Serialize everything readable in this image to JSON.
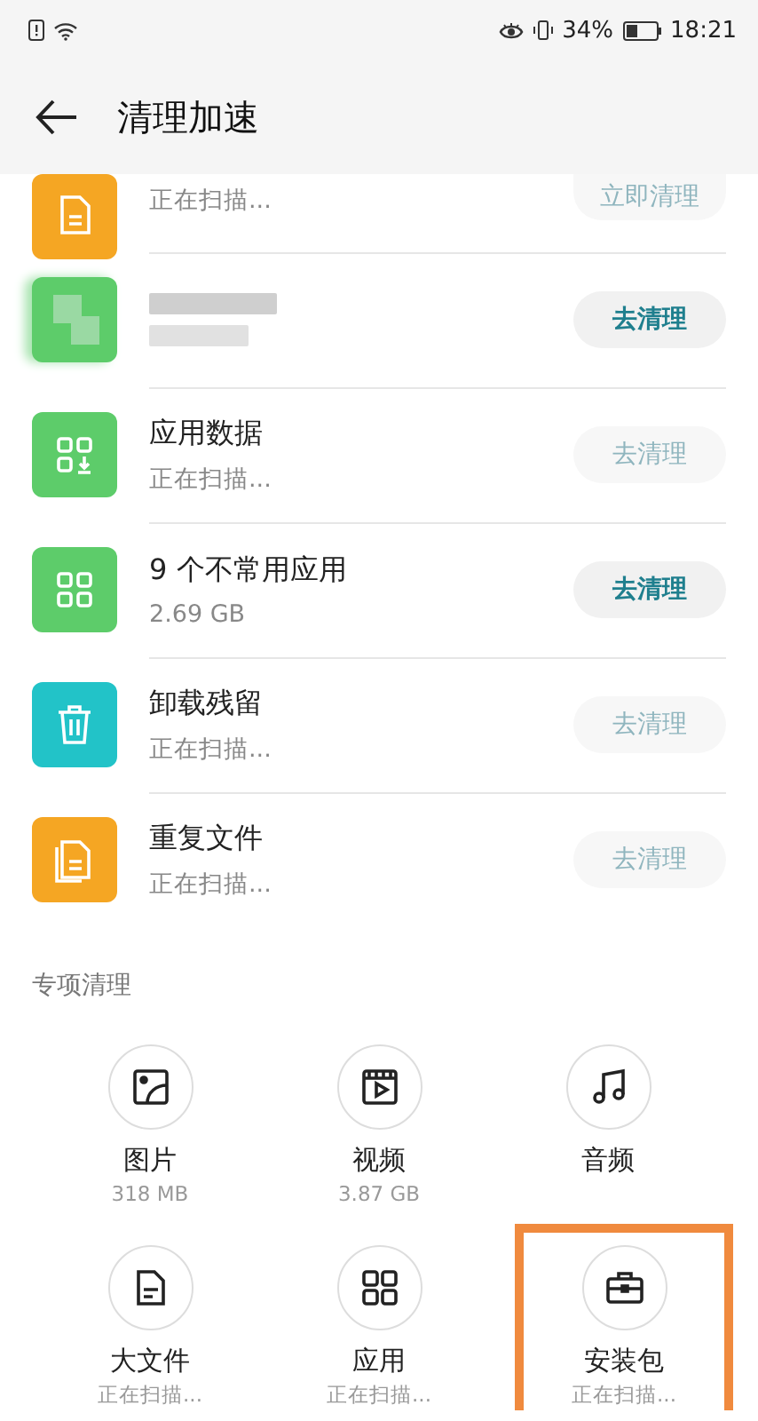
{
  "status_bar": {
    "battery": "34%",
    "time": "18:21"
  },
  "header": {
    "title": "清理加速"
  },
  "rows": [
    {
      "kind": "cut",
      "color": "#f5a623",
      "subtitle": "正在扫描...",
      "button": "立即清理",
      "disabled": true
    },
    {
      "kind": "blurred",
      "color": "#5dcc6a",
      "button": "去清理",
      "disabled": false
    },
    {
      "kind": "normal",
      "color": "#5dcc6a",
      "title": "应用数据",
      "subtitle": "正在扫描...",
      "button": "去清理",
      "disabled": true
    },
    {
      "kind": "normal",
      "color": "#5dcc6a",
      "title": "9 个不常用应用",
      "subtitle": "2.69 GB",
      "button": "去清理",
      "disabled": false
    },
    {
      "kind": "normal",
      "color": "#22c3c8",
      "title": "卸载残留",
      "subtitle": "正在扫描...",
      "button": "去清理",
      "disabled": true
    },
    {
      "kind": "normal",
      "color": "#f5a623",
      "title": "重复文件",
      "subtitle": "正在扫描...",
      "button": "去清理",
      "disabled": true
    }
  ],
  "special": {
    "title": "专项清理",
    "items": [
      {
        "label": "图片",
        "detail": "318 MB",
        "highlighted": false
      },
      {
        "label": "视频",
        "detail": "3.87 GB",
        "highlighted": false
      },
      {
        "label": "音频",
        "highlighted": false
      },
      {
        "label": "大文件",
        "detail": "正在扫描...",
        "highlighted": false
      },
      {
        "label": "应用",
        "detail": "正在扫描...",
        "highlighted": false
      },
      {
        "label": "安装包",
        "detail": "正在扫描...",
        "highlighted": true
      }
    ]
  }
}
